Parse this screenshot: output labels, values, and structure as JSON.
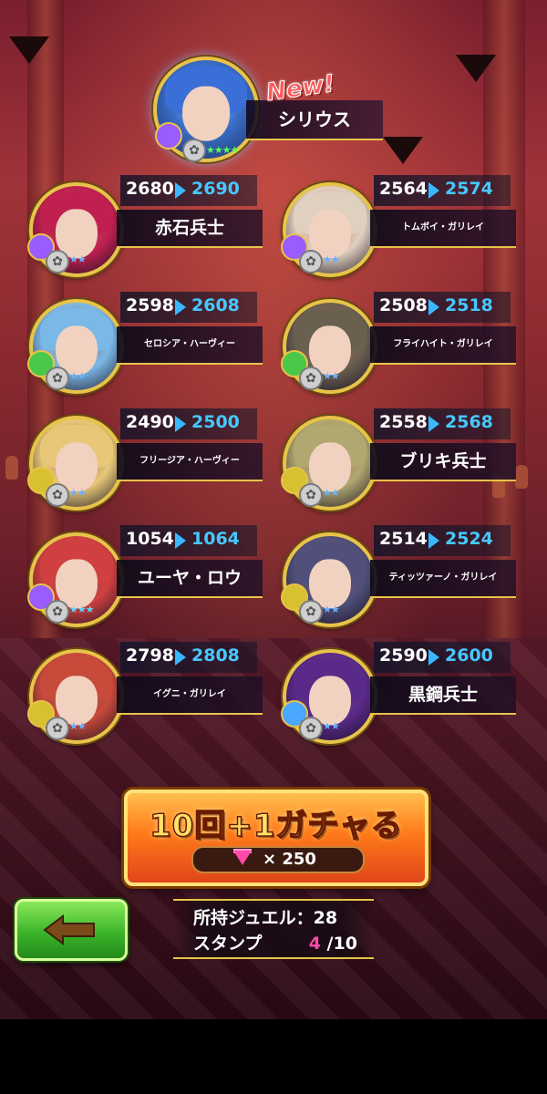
{
  "featured": {
    "badge": "New!",
    "name": "シリウス",
    "stars": "★★★★"
  },
  "characters": [
    {
      "name": "赤石兵士",
      "old": "2680",
      "new": "2690",
      "stars": "★★",
      "size": "lg",
      "color": "#c02050",
      "elem": "#9a5cff"
    },
    {
      "name": "トムボイ・ガリレイ",
      "old": "2564",
      "new": "2574",
      "stars": "★★",
      "size": "sm",
      "color": "#e0d0c0",
      "elem": "#9a5cff"
    },
    {
      "name": "セロシア・ハーヴィー",
      "old": "2598",
      "new": "2608",
      "stars": "★★",
      "size": "sm",
      "color": "#7ab8e8",
      "elem": "#4ac84a"
    },
    {
      "name": "フライハイト・ガリレイ",
      "old": "2508",
      "new": "2518",
      "stars": "★★",
      "size": "sm",
      "color": "#6a6050",
      "elem": "#4ac84a"
    },
    {
      "name": "フリージア・ハーヴィー",
      "old": "2490",
      "new": "2500",
      "stars": "★★",
      "size": "sm",
      "color": "#e8c878",
      "elem": "#d8c030"
    },
    {
      "name": "ブリキ兵士",
      "old": "2558",
      "new": "2568",
      "stars": "★★",
      "size": "lg",
      "color": "#b0a870",
      "elem": "#d8c030"
    },
    {
      "name": "ユーヤ・ロウ",
      "old": "1054",
      "new": "1064",
      "stars": "★★★",
      "size": "lg",
      "color": "#d04040",
      "elem": "#9a5cff"
    },
    {
      "name": "ティッツァーノ・ガリレイ",
      "old": "2514",
      "new": "2524",
      "stars": "★★",
      "size": "sm",
      "color": "#50507a",
      "elem": "#d8c030"
    },
    {
      "name": "イグニ・ガリレイ",
      "old": "2798",
      "new": "2808",
      "stars": "★★",
      "size": "sm",
      "color": "#c84a3a",
      "elem": "#d8c030"
    },
    {
      "name": "黒鋼兵士",
      "old": "2590",
      "new": "2600",
      "stars": "★★",
      "size": "lg",
      "color": "#5a2a8a",
      "elem": "#4aa8ff"
    }
  ],
  "gacha": {
    "label": "10回+1ガチャる",
    "cost": "× 250"
  },
  "status": {
    "jewel_label": "所持ジュエル：28",
    "stamp_label": "スタンプ",
    "stamp_current": "4",
    "stamp_total": "/10"
  },
  "colors": {
    "gold": "#e8c34a",
    "stat_new": "#46c8ff",
    "stamp": "#ff4aa8"
  }
}
